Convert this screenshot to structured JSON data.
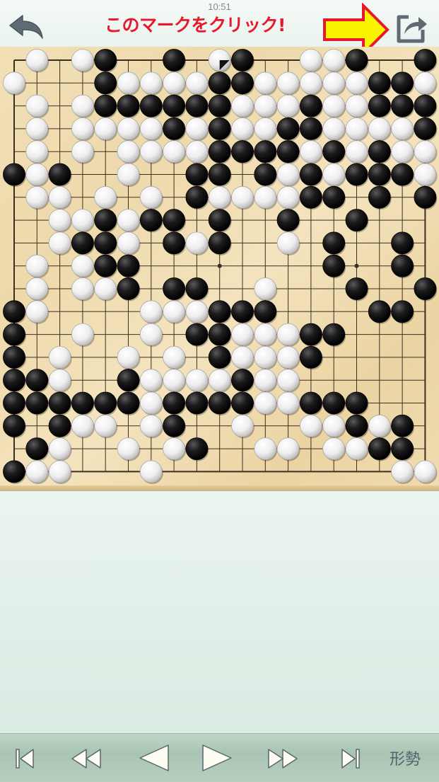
{
  "status_bar": {
    "time": "10:51"
  },
  "header": {
    "annotation": "このマークをクリック!",
    "back_icon": "back-arrow-icon",
    "share_icon": "share-export-icon",
    "arrow_color": "#f8f400",
    "arrow_outline": "#e8192c"
  },
  "board": {
    "size": 19,
    "last_move": {
      "col": 9,
      "row": 0,
      "color": "W"
    },
    "rows": [
      ".W.WB..B.WB..WWB..B",
      "W...BWWWWBBWWWWWBBW",
      ".W.WBBBBBBWWWBWWBBB",
      ".W.WWWWBWBWWBBWWWWB",
      ".W.W.WWWWBBBBWBWBWW",
      "BWB..W..BB.BWBWBBBW",
      ".WW.W.W.BWWWWBB.B.B",
      "..WWBWBB.B..B..B...",
      "..WBBW.BWB..W.B..B.",
      ".W.WBB........B..B.",
      ".W.WWB.BB..W...B..B",
      "BW....WWWBBB....BB.",
      "B..W..W.BBWWWBB....",
      "B.W..W.W.BWWWB.....",
      "BBW..BWWWWBWW......",
      "BBBBBBWBBBBWWBBB...",
      "B.BWW.WB..W..WWBWB.",
      ".BW..W.WB..WW.WWBB.",
      "BWW...W..........WW"
    ],
    "star_points": [
      [
        3,
        3
      ],
      [
        3,
        9
      ],
      [
        3,
        15
      ],
      [
        9,
        3
      ],
      [
        9,
        9
      ],
      [
        9,
        15
      ],
      [
        15,
        3
      ],
      [
        15,
        9
      ],
      [
        15,
        15
      ]
    ],
    "colors": {
      "wood": "#f0dcb0",
      "line": "#3b2f22",
      "black_stone": "#141414",
      "white_stone": "#f4f4f4"
    }
  },
  "toolbar": {
    "first": "skip-to-first-icon",
    "rewind": "fast-rewind-icon",
    "prev": "previous-icon",
    "next": "next-icon",
    "forward": "fast-forward-icon",
    "last": "skip-to-last-icon",
    "situation_label": "形勢"
  }
}
